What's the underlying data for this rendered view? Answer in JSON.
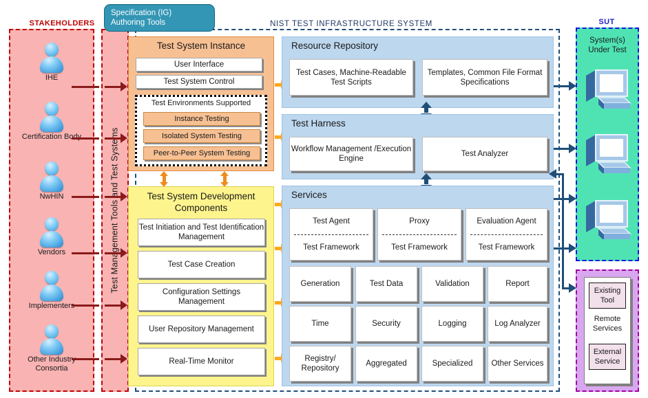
{
  "captions": {
    "stakeholders": "STAKEHOLDERS",
    "nist": "NIST TEST INFRASTRUCTURE  SYSTEM",
    "sut": "SUT"
  },
  "spec_tool": {
    "line1": "Specification (IG)",
    "line2": "Authoring Tools"
  },
  "test_management_label": "Test Management Tools and Test Systems",
  "stakeholders": [
    {
      "label": "IHE",
      "icon": "person-icon"
    },
    {
      "label": "Certification Body",
      "icon": "person-icon"
    },
    {
      "label": "NwHIN",
      "icon": "person-icon"
    },
    {
      "label": "Vendors",
      "icon": "person-icon"
    },
    {
      "label": "Implementers",
      "icon": "person-icon"
    },
    {
      "label": "Other Industry Consortia",
      "icon": "person-icon"
    }
  ],
  "test_system_instance": {
    "title": "Test System Instance",
    "user_interface": "User Interface",
    "test_system_control": "Test System Control",
    "environments_title": "Test Environments Supported",
    "environments": [
      "Instance Testing",
      "Isolated System Testing",
      "Peer-to-Peer System Testing"
    ]
  },
  "development_components": {
    "title": "Test System Development Components",
    "items": [
      "Test Initiation and Test Identification Management",
      "Test Case Creation",
      "Configuration Settings Management",
      "User Repository Management",
      "Real-Time Monitor"
    ]
  },
  "resource_repository": {
    "title": "Resource Repository",
    "items": [
      "Test Cases, Machine-Readable Test Scripts",
      "Templates, Common File Format Specifications"
    ]
  },
  "test_harness": {
    "title": "Test Harness",
    "items": [
      "Workflow Management /Execution Engine",
      "Test Analyzer"
    ]
  },
  "services": {
    "title": "Services",
    "agents": [
      {
        "name": "Test Agent",
        "framework": "Test Framework"
      },
      {
        "name": "Proxy",
        "framework": "Test Framework"
      },
      {
        "name": "Evaluation Agent",
        "framework": "Test Framework"
      }
    ],
    "grid": [
      "Generation",
      "Test Data",
      "Validation",
      "Report",
      "Time",
      "Security",
      "Logging",
      "Log Analyzer",
      "Registry/ Repository",
      "Aggregated",
      "Specialized",
      "Other Services"
    ]
  },
  "sut": {
    "title": "System(s) Under Test",
    "computer_icon": "computer-icon"
  },
  "remote_services": {
    "existing_tool": "Existing Tool",
    "label": "Remote Services",
    "external_service": "External Service"
  },
  "colors": {
    "stakeholder_fill": "#f9b3b3",
    "stakeholder_border": "#c00000",
    "nist_border": "#1f4e79",
    "instance_fill": "#f7c093",
    "development_fill": "#fdf48d",
    "panel_fill": "#bdd7ee",
    "sut_fill": "#4fe3b4",
    "sut_border": "#1414e0",
    "remote_fill": "#d9a7f0",
    "remote_border": "#a000a0",
    "spec_tool_fill": "#3396b5",
    "orange_arrow": "#ffa81e",
    "navy_arrow": "#1f4e79",
    "red_arrow": "#8b1a1a"
  }
}
